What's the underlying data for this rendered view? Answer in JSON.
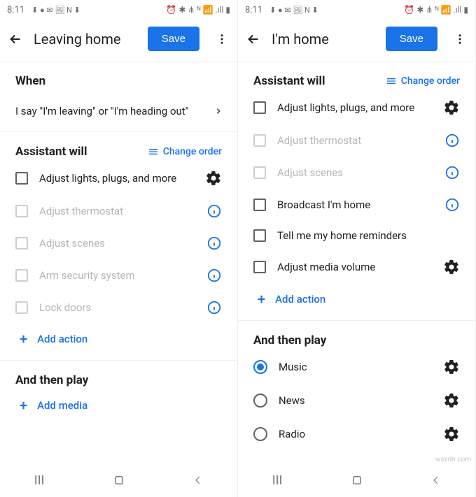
{
  "statusbar": {
    "time": "8:11",
    "left_icons": "⬇ ● ✉ 🖼 N ⬇",
    "right_icons": "⏰ ✱ ⋔ ᴺ 📶 .ıll ▮"
  },
  "left": {
    "title": "Leaving home",
    "save": "Save",
    "when_heading": "When",
    "when_text": "I say \"I'm leaving\" or \"I'm heading out\"",
    "assistant_heading": "Assistant will",
    "change_order": "Change order",
    "actions": [
      {
        "label": "Adjust lights, plugs, and more",
        "state": "enabled",
        "trailing": "gear"
      },
      {
        "label": "Adjust thermostat",
        "state": "disabled",
        "trailing": "info"
      },
      {
        "label": "Adjust scenes",
        "state": "disabled",
        "trailing": "info"
      },
      {
        "label": "Arm security system",
        "state": "disabled",
        "trailing": "info"
      },
      {
        "label": "Lock doors",
        "state": "disabled",
        "trailing": "info"
      }
    ],
    "add_action": "Add action",
    "play_heading": "And then play",
    "add_media": "Add media"
  },
  "right": {
    "title": "I'm home",
    "save": "Save",
    "assistant_heading": "Assistant will",
    "change_order": "Change order",
    "actions": [
      {
        "label": "Adjust lights, plugs, and more",
        "state": "enabled",
        "trailing": "gear"
      },
      {
        "label": "Adjust thermostat",
        "state": "disabled",
        "trailing": "info"
      },
      {
        "label": "Adjust scenes",
        "state": "disabled",
        "trailing": "info"
      },
      {
        "label": "Broadcast I'm home",
        "state": "enabled",
        "trailing": "info"
      },
      {
        "label": "Tell me my home reminders",
        "state": "enabled",
        "trailing": "none"
      },
      {
        "label": "Adjust media volume",
        "state": "enabled",
        "trailing": "gear"
      }
    ],
    "add_action": "Add action",
    "play_heading": "And then play",
    "play_items": [
      {
        "label": "Music",
        "selected": true
      },
      {
        "label": "News",
        "selected": false
      },
      {
        "label": "Radio",
        "selected": false
      }
    ]
  },
  "watermark": "wsxdn.com"
}
